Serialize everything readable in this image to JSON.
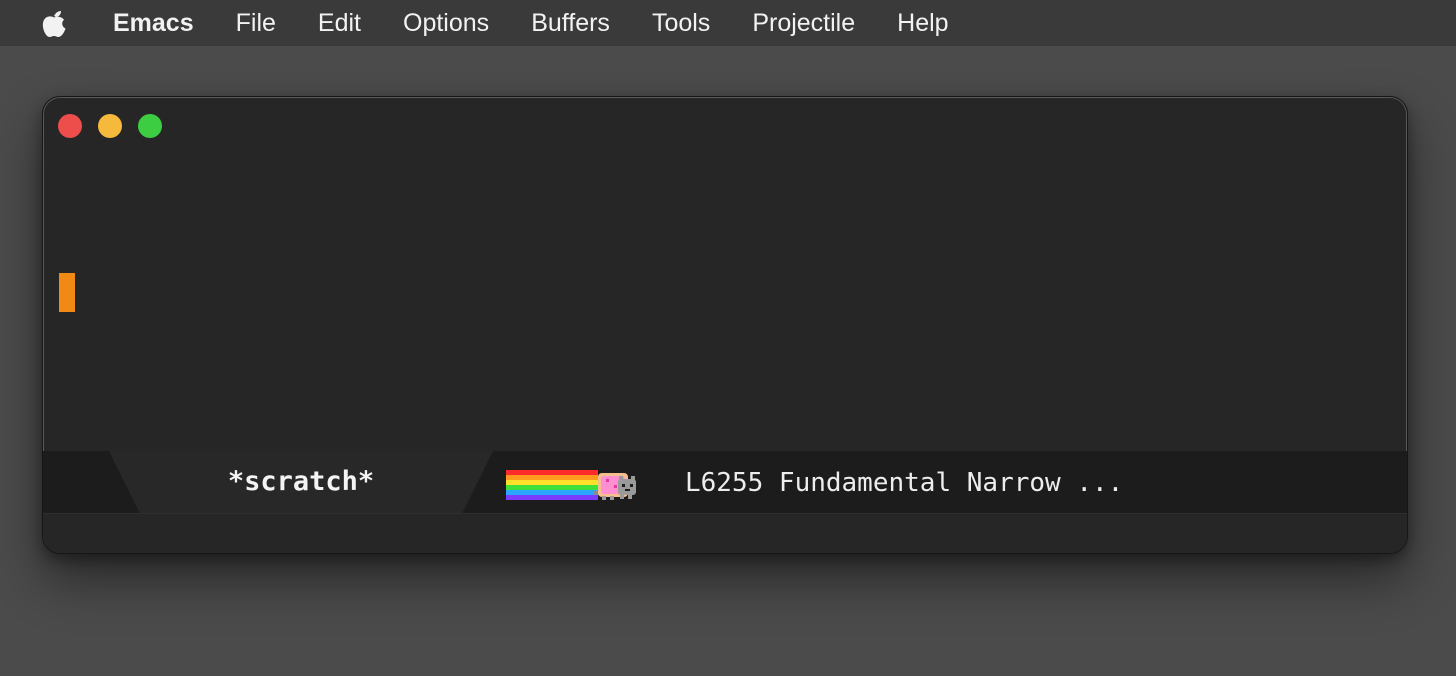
{
  "menubar": {
    "apple_icon": "apple-icon",
    "items": [
      "Emacs",
      "File",
      "Edit",
      "Options",
      "Buffers",
      "Tools",
      "Projectile",
      "Help"
    ]
  },
  "window": {
    "traffic_lights": {
      "close_color": "#ed4e4b",
      "minimize_color": "#f5b93b",
      "maximize_color": "#3ccd43"
    },
    "cursor_color": "#f08a14",
    "modeline": {
      "buffer_name": "*scratch*",
      "indicator_icon": "nyan-cat-icon",
      "info": "L6255 Fundamental Narrow ..."
    }
  }
}
